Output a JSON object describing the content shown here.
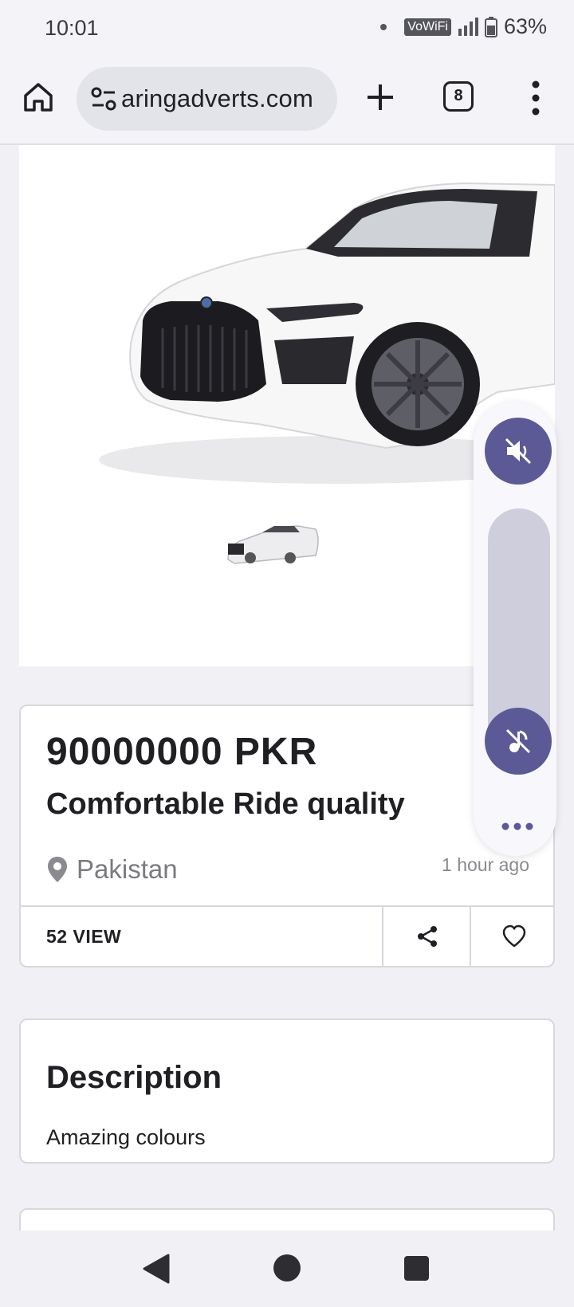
{
  "status_bar": {
    "time": "10:01",
    "wifi_label": "VoWiFi",
    "battery": "63%"
  },
  "browser": {
    "url": "aringadverts.com",
    "tab_count": "8"
  },
  "listing": {
    "price": "90000000 PKR",
    "title": "Comfortable Ride quality",
    "location": "Pakistan",
    "posted": "1 hour ago",
    "views": "52 VIEW"
  },
  "description": {
    "heading": "Description",
    "text": "Amazing colours"
  },
  "colors": {
    "accent": "#5b5a96",
    "card_border": "#d7d7de",
    "page_bg": "#f1f1f5"
  }
}
